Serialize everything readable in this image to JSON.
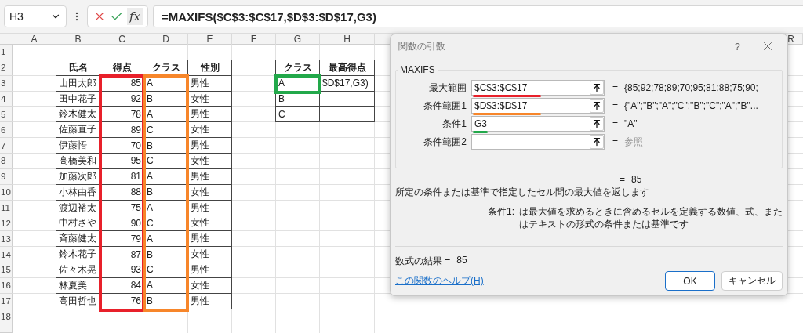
{
  "formula_bar": {
    "name_box": "H3",
    "fx": "fx",
    "formula": "=MAXIFS($C$3:$C$17,$D$3:$D$17,G3)"
  },
  "columns": [
    "A",
    "B",
    "C",
    "D",
    "E",
    "F",
    "G",
    "H"
  ],
  "far_column": "R",
  "row_numbers": [
    "1",
    "2",
    "3",
    "4",
    "5",
    "6",
    "7",
    "8",
    "9",
    "10",
    "11",
    "12",
    "13",
    "14",
    "15",
    "16",
    "17",
    "18"
  ],
  "score_table": {
    "headers": [
      "氏名",
      "得点",
      "クラス",
      "性別"
    ],
    "rows": [
      [
        "山田太郎",
        "85",
        "A",
        "男性"
      ],
      [
        "田中花子",
        "92",
        "B",
        "女性"
      ],
      [
        "鈴木健太",
        "78",
        "A",
        "男性"
      ],
      [
        "佐藤直子",
        "89",
        "C",
        "女性"
      ],
      [
        "伊藤悟",
        "70",
        "B",
        "男性"
      ],
      [
        "高橋美和",
        "95",
        "C",
        "女性"
      ],
      [
        "加藤次郎",
        "81",
        "A",
        "男性"
      ],
      [
        "小林由香",
        "88",
        "B",
        "女性"
      ],
      [
        "渡辺裕太",
        "75",
        "A",
        "男性"
      ],
      [
        "中村さや",
        "90",
        "C",
        "女性"
      ],
      [
        "斉藤健太",
        "79",
        "A",
        "男性"
      ],
      [
        "鈴木花子",
        "87",
        "B",
        "女性"
      ],
      [
        "佐々木晃",
        "93",
        "C",
        "男性"
      ],
      [
        "林夏美",
        "84",
        "A",
        "女性"
      ],
      [
        "高田哲也",
        "76",
        "B",
        "男性"
      ]
    ]
  },
  "lookup_table": {
    "headers": [
      "クラス",
      "最高得点"
    ],
    "rows": [
      {
        "class": "A",
        "max": "$D$17,G3)"
      },
      {
        "class": "B"
      },
      {
        "class": "C"
      }
    ]
  },
  "highlights": [
    {
      "kind": "score_column",
      "color": "#e8202a"
    },
    {
      "kind": "class_column",
      "color": "#f7862a"
    },
    {
      "kind": "criteria_cell",
      "color": "#22a84a"
    }
  ],
  "dialog": {
    "title": "関数の引数",
    "help": "?",
    "function": "MAXIFS",
    "args": [
      {
        "label": "最大範囲",
        "value": "$C$3:$C$17",
        "eq": "=",
        "result": "{85;92;78;89;70;95;81;88;75;90;",
        "dimmed": false,
        "color": "#e8202a"
      },
      {
        "label": "条件範囲1",
        "value": "$D$3:$D$17",
        "eq": "=",
        "result": "{\"A\";\"B\";\"A\";\"C\";\"B\";\"C\";\"A\";\"B\"...",
        "dimmed": false,
        "color": "#f7862a"
      },
      {
        "label": "条件1",
        "value": "G3",
        "eq": "=",
        "result": "\"A\"",
        "dimmed": false,
        "color": "#22a84a"
      },
      {
        "label": "条件範囲2",
        "eq": "=",
        "result": "参照",
        "dimmed": true
      }
    ],
    "total_eq": "=",
    "total": "85",
    "description": "所定の条件または基準で指定したセル間の最大値を返します",
    "arg_help_label": "条件1:",
    "arg_help": "は最大値を求めるときに含めるセルを定義する数値、式、またはテキストの形式の条件または基準です",
    "result_label": "数式の結果 =",
    "result": "85",
    "help_link": "この関数のヘルプ(H)",
    "buttons": [
      {
        "label": "OK",
        "default": true
      },
      {
        "label": "キャンセル",
        "default": false
      }
    ]
  }
}
